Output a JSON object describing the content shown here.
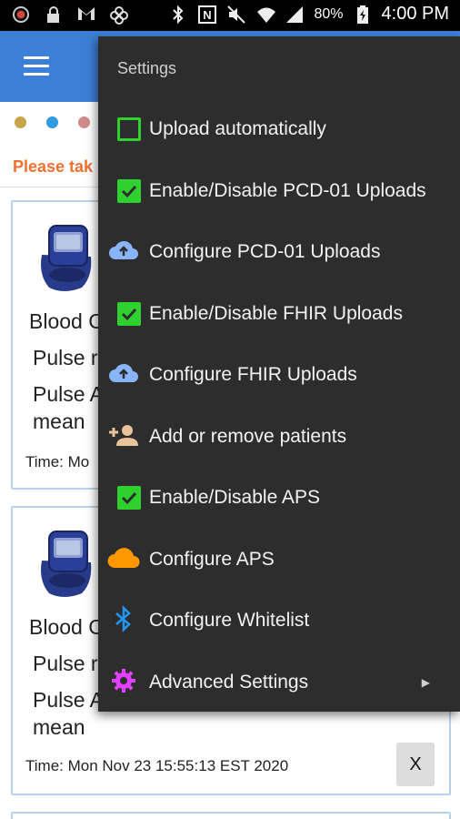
{
  "status_bar": {
    "battery": "80%",
    "time": "4:00 PM",
    "icons": [
      "recording-icon",
      "lock-icon",
      "gmail-icon",
      "pinwheel-icon",
      "bluetooth-icon",
      "nfc-icon",
      "mute-icon",
      "wifi-icon",
      "signal-icon",
      "battery-icon"
    ]
  },
  "colors": {
    "toolbar": "#3c7fd6",
    "menu_bg": "#2d2d2d",
    "checkbox": "#2fd12f",
    "upload_icon": "#8ab4f8",
    "aps_icon": "#ff9800",
    "bluetooth_icon": "#2196f3",
    "settings_icon": "#e040fb",
    "notice": "#f07030",
    "dots": [
      "#c8a44a",
      "#2f9be0",
      "#d08a8a"
    ]
  },
  "main": {
    "notice_text": "Please tak",
    "cards": [
      {
        "lines": [
          "Blood C",
          "Pulse r",
          "Pulse A",
          "mean"
        ],
        "time_text": "Time: Mo"
      },
      {
        "lines": [
          "Blood C",
          "Pulse r",
          "Pulse A",
          "mean"
        ],
        "time_text": "Time: Mon Nov 23 15:55:13 EST 2020",
        "close_label": "X"
      }
    ]
  },
  "menu": {
    "title": "Settings",
    "items": [
      {
        "label": "Upload automatically",
        "icon": "checkbox-unchecked-icon"
      },
      {
        "label": "Enable/Disable PCD-01 Uploads",
        "icon": "checkbox-checked-icon"
      },
      {
        "label": "Configure PCD-01 Uploads",
        "icon": "cloud-upload-icon"
      },
      {
        "label": "Enable/Disable FHIR Uploads",
        "icon": "checkbox-checked-icon"
      },
      {
        "label": "Configure FHIR Uploads",
        "icon": "cloud-upload-icon"
      },
      {
        "label": "Add or remove patients",
        "icon": "add-person-icon"
      },
      {
        "label": "Enable/Disable APS",
        "icon": "checkbox-checked-icon"
      },
      {
        "label": "Configure APS",
        "icon": "cloud-icon"
      },
      {
        "label": "Configure Whitelist",
        "icon": "bluetooth-icon"
      },
      {
        "label": "Advanced Settings",
        "icon": "gear-icon",
        "submenu": true
      }
    ]
  }
}
